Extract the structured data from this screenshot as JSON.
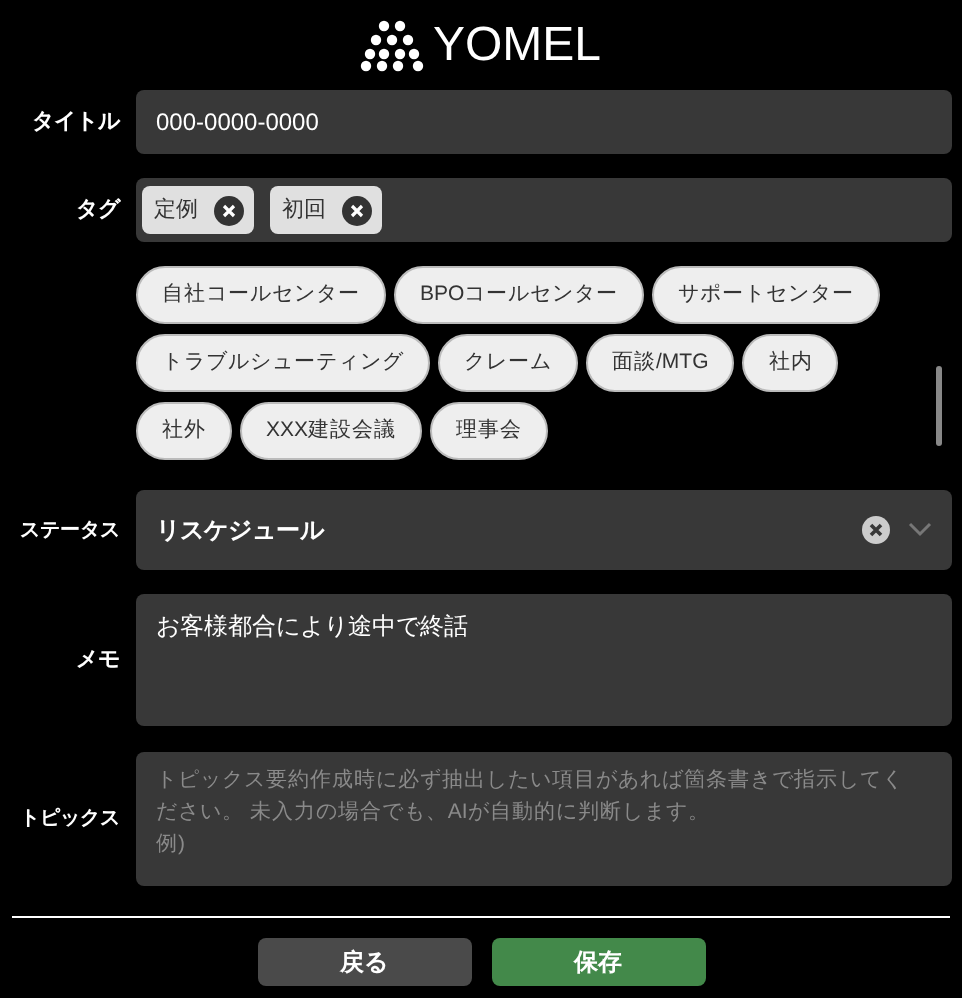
{
  "logo": {
    "text": "YOMEL"
  },
  "fields": {
    "title": {
      "label": "タイトル",
      "value": "000-0000-0000"
    },
    "tags": {
      "label": "タグ",
      "selected_tags": [
        "定例",
        "初回"
      ],
      "options": [
        "自社コールセンター",
        "BPOコールセンター",
        "サポートセンター",
        "トラブルシューティング",
        "クレーム",
        "面談/MTG",
        "社内",
        "社外",
        "XXX建設会議",
        "理事会"
      ]
    },
    "status": {
      "label": "ステータス",
      "value": "リスケジュール"
    },
    "memo": {
      "label": "メモ",
      "value": "お客様都合により途中で終話"
    },
    "topics": {
      "label": "トピックス",
      "placeholder_lines": [
        "トピックス要約作成時に必ず抽出したい項目があれば箇条書きで指示してください。 未入力の場合でも、AIが自動的に判断します。",
        "例)"
      ]
    }
  },
  "buttons": [
    {
      "label": "戻る",
      "kind": "secondary"
    },
    {
      "label": "保存",
      "kind": "primary"
    }
  ]
}
